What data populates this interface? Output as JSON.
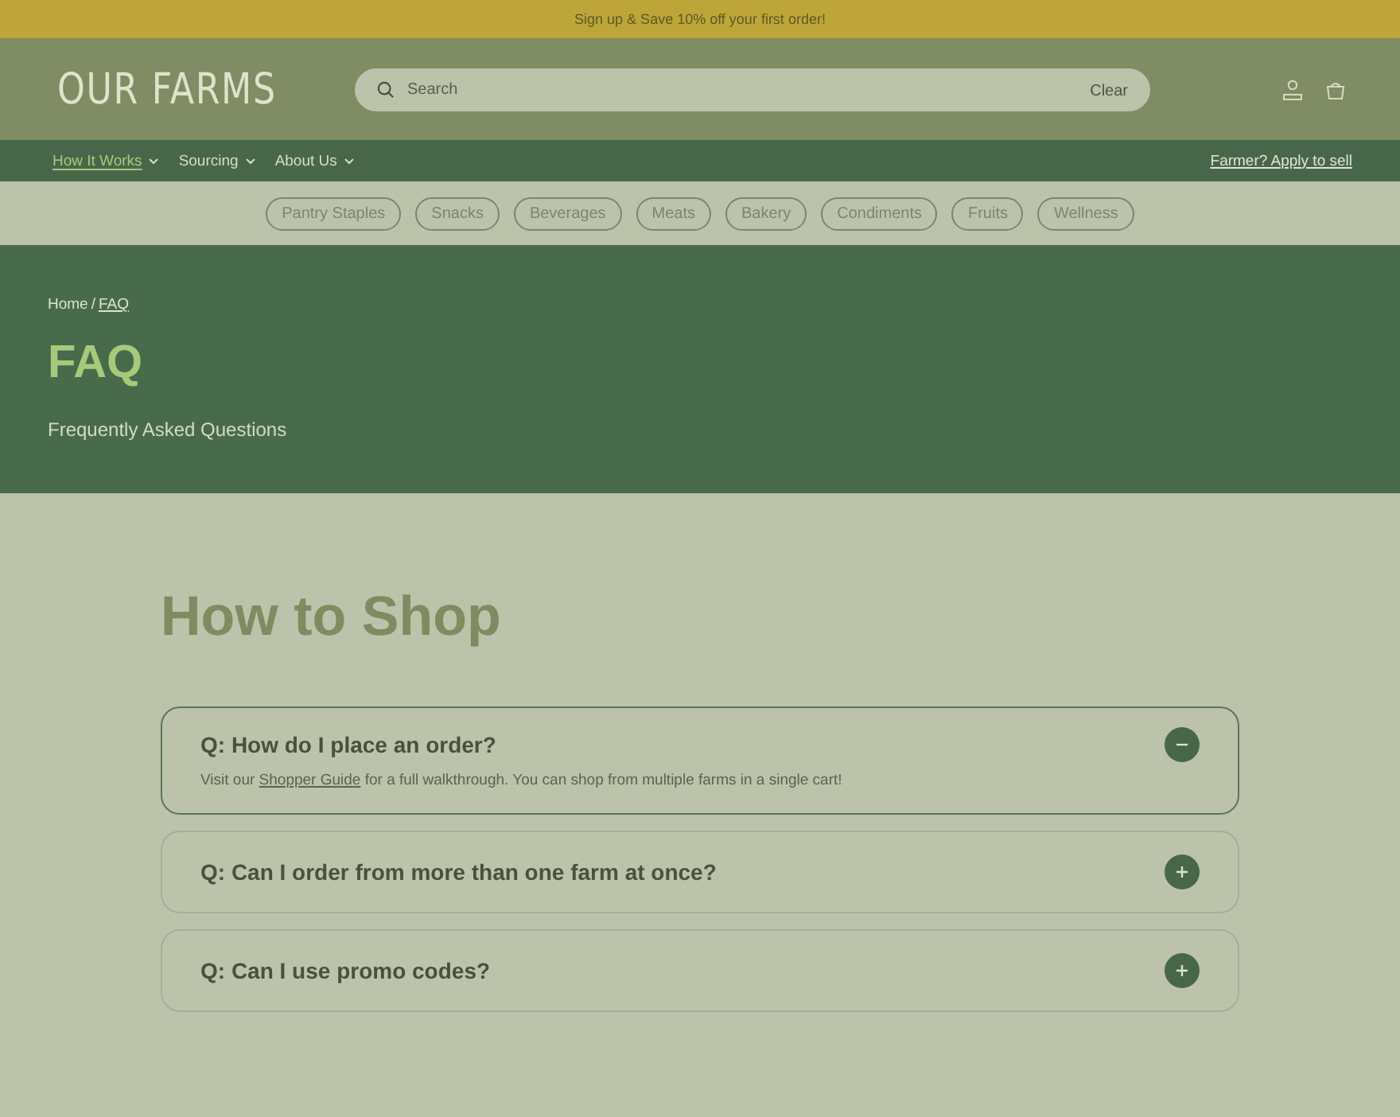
{
  "banner": {
    "text": "Sign up & Save 10% off your first order!"
  },
  "header": {
    "logo": "OUR FARMS",
    "search": {
      "placeholder": "Search",
      "clear": "Clear"
    }
  },
  "nav": {
    "items": [
      {
        "label": "How It Works",
        "selected": true
      },
      {
        "label": "Sourcing",
        "selected": false
      },
      {
        "label": "About Us",
        "selected": false
      }
    ],
    "cta": "Farmer? Apply to sell"
  },
  "categories": [
    "Pantry Staples",
    "Snacks",
    "Beverages",
    "Meats",
    "Bakery",
    "Condiments",
    "Fruits",
    "Wellness"
  ],
  "hero": {
    "breadcrumb": {
      "home": "Home",
      "separator": "/",
      "current": "FAQ"
    },
    "title": "FAQ",
    "subtitle": "Frequently Asked Questions"
  },
  "section": {
    "title": "How to Shop",
    "faqs": [
      {
        "question": "Q: How do I place an order?",
        "expanded": true,
        "answer": {
          "before": "Visit our ",
          "link": "Shopper Guide",
          "after": " for a full walkthrough. You can shop from multiple farms in a single cart!"
        }
      },
      {
        "question": "Q: Can I order from more than one farm at once?",
        "expanded": false
      },
      {
        "question": "Q: Can I use promo codes?",
        "expanded": false
      }
    ]
  }
}
